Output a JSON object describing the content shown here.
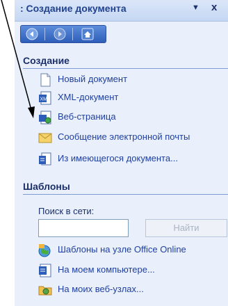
{
  "pane": {
    "title": ": Создание документа",
    "dropdown_icon": "▼",
    "close_icon": "x"
  },
  "nav": {
    "back_icon": "back-arrow",
    "forward_icon": "forward-arrow",
    "home_icon": "home"
  },
  "create": {
    "heading": "Создание",
    "items": [
      {
        "label": "Новый документ",
        "icon": "blank-document"
      },
      {
        "label": "XML-документ",
        "icon": "xml-document"
      },
      {
        "label": "Веб-страница",
        "icon": "web-page"
      },
      {
        "label": "Сообщение электронной почты",
        "icon": "email-envelope"
      },
      {
        "label": "Из имеющегося документа...",
        "icon": "document-from-existing"
      }
    ]
  },
  "templates": {
    "heading": "Шаблоны",
    "search_label": "Поиск в сети:",
    "search_value": "",
    "search_button": "Найти",
    "items": [
      {
        "label": "Шаблоны на узле Office Online",
        "icon": "globe"
      },
      {
        "label": "На моем компьютере...",
        "icon": "computer-templates"
      },
      {
        "label": "На моих веб-узлах...",
        "icon": "web-folder"
      }
    ]
  }
}
